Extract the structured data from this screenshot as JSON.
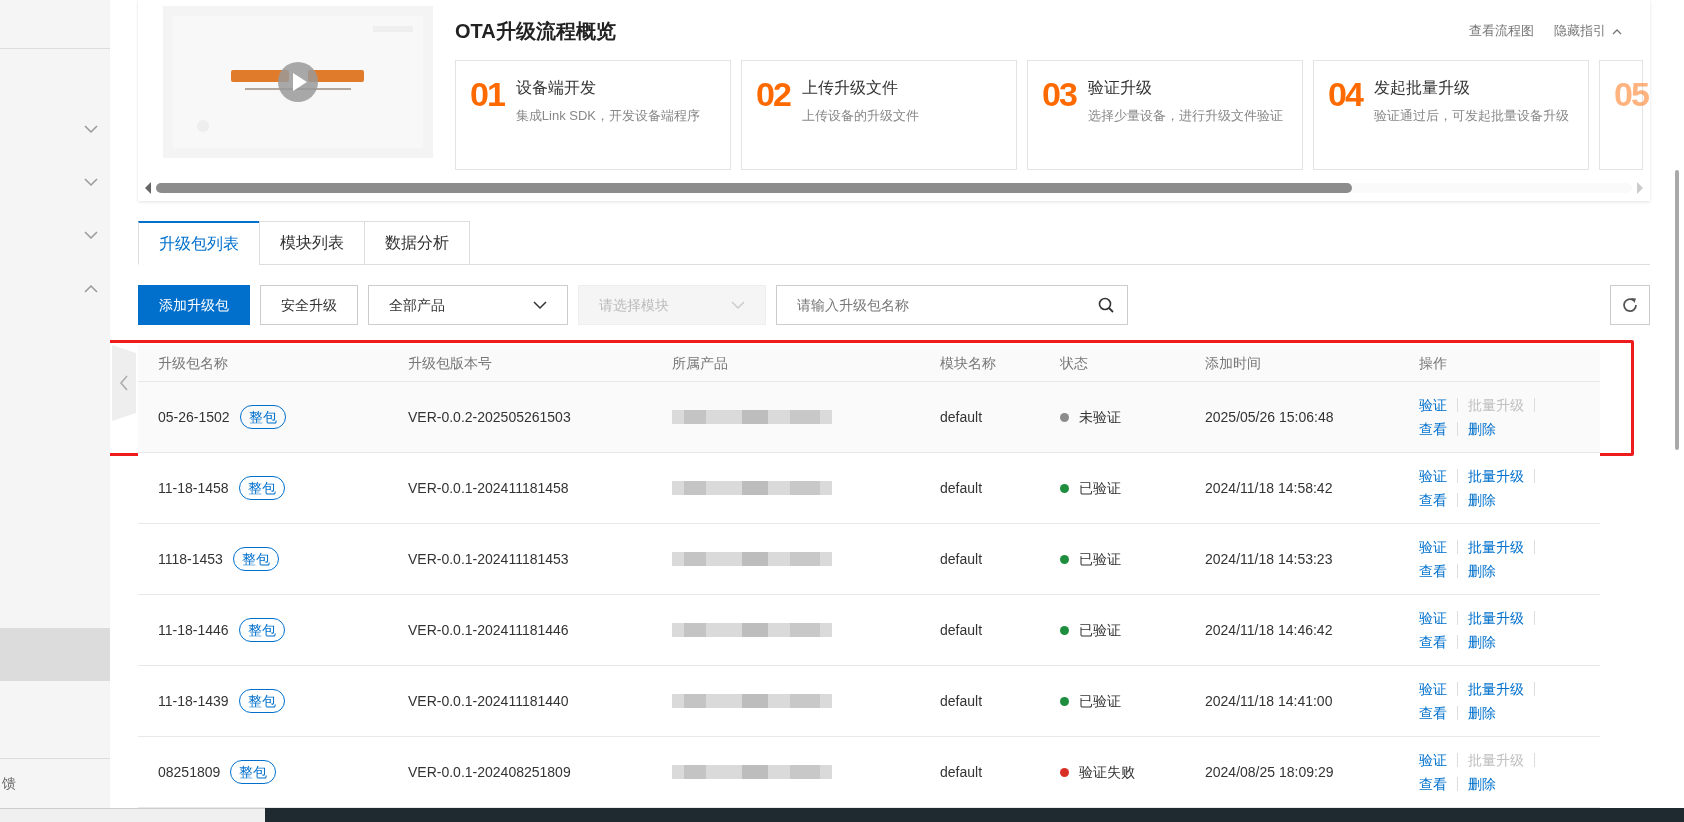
{
  "sidebar": {
    "groups": [
      {
        "expanded": false
      },
      {
        "expanded": false
      },
      {
        "expanded": false
      },
      {
        "expanded": true
      }
    ],
    "items": [
      {
        "selected": true
      }
    ],
    "footer_link": "馈"
  },
  "guide": {
    "title": "OTA升级流程概览",
    "links": [
      "查看流程图",
      "隐藏指引"
    ],
    "expanded": true,
    "steps": [
      {
        "number": "01",
        "title": "设备端开发",
        "desc": "集成Link SDK，开发设备端程序"
      },
      {
        "number": "02",
        "title": "上传升级文件",
        "desc": "上传设备的升级文件"
      },
      {
        "number": "03",
        "title": "验证升级",
        "desc": "选择少量设备，进行升级文件验证"
      },
      {
        "number": "04",
        "title": "发起批量升级",
        "desc": "验证通过后，可发起批量设备升级"
      },
      {
        "number": "05"
      }
    ]
  },
  "tabs": [
    {
      "label": "升级包列表",
      "selected": true
    },
    {
      "label": "模块列表",
      "selected": false
    },
    {
      "label": "数据分析",
      "selected": false
    }
  ],
  "toolbar": {
    "primary_button": "添加升级包",
    "secure_button": "安全升级",
    "product_select": {
      "value": "全部产品",
      "disabled": false
    },
    "module_select": {
      "placeholder": "请选择模块",
      "disabled": true
    },
    "search": {
      "placeholder": "请输入升级包名称"
    }
  },
  "table": {
    "columns": [
      "升级包名称",
      "升级包版本号",
      "所属产品",
      "模块名称",
      "状态",
      "添加时间",
      "操作"
    ],
    "rows": [
      {
        "name": "05-26-1502",
        "tag": "整包",
        "version": "VER-0.0.2-202505261503",
        "module": "default",
        "status": "未验证",
        "color": "#8c8c8c",
        "time": "2025/05/26 15:06:48",
        "highlighted": true,
        "actions": [
          {
            "label": "验证",
            "disabled": false
          },
          {
            "label": "批量升级",
            "disabled": true
          },
          {
            "label": "查看",
            "disabled": false
          },
          {
            "label": "删除",
            "disabled": false
          }
        ]
      },
      {
        "name": "11-18-1458",
        "tag": "整包",
        "version": "VER-0.0.1-202411181458",
        "module": "default",
        "status": "已验证",
        "color": "#1e8e3e",
        "time": "2024/11/18 14:58:42",
        "highlighted": false,
        "actions": [
          {
            "label": "验证",
            "disabled": false
          },
          {
            "label": "批量升级",
            "disabled": false
          },
          {
            "label": "查看",
            "disabled": false
          },
          {
            "label": "删除",
            "disabled": false
          }
        ]
      },
      {
        "name": "1118-1453",
        "tag": "整包",
        "version": "VER-0.0.1-202411181453",
        "module": "default",
        "status": "已验证",
        "color": "#1e8e3e",
        "time": "2024/11/18 14:53:23",
        "highlighted": false,
        "actions": [
          {
            "label": "验证",
            "disabled": false
          },
          {
            "label": "批量升级",
            "disabled": false
          },
          {
            "label": "查看",
            "disabled": false
          },
          {
            "label": "删除",
            "disabled": false
          }
        ]
      },
      {
        "name": "11-18-1446",
        "tag": "整包",
        "version": "VER-0.0.1-202411181446",
        "module": "default",
        "status": "已验证",
        "color": "#1e8e3e",
        "time": "2024/11/18 14:46:42",
        "highlighted": false,
        "actions": [
          {
            "label": "验证",
            "disabled": false
          },
          {
            "label": "批量升级",
            "disabled": false
          },
          {
            "label": "查看",
            "disabled": false
          },
          {
            "label": "删除",
            "disabled": false
          }
        ]
      },
      {
        "name": "11-18-1439",
        "tag": "整包",
        "version": "VER-0.0.1-202411181440",
        "module": "default",
        "status": "已验证",
        "color": "#1e8e3e",
        "time": "2024/11/18 14:41:00",
        "highlighted": false,
        "actions": [
          {
            "label": "验证",
            "disabled": false
          },
          {
            "label": "批量升级",
            "disabled": false
          },
          {
            "label": "查看",
            "disabled": false
          },
          {
            "label": "删除",
            "disabled": false
          }
        ]
      },
      {
        "name": "08251809",
        "tag": "整包",
        "version": "VER-0.0.1-202408251809",
        "module": "default",
        "status": "验证失败",
        "color": "#d93026",
        "time": "2024/08/25 18:09:29",
        "highlighted": false,
        "actions": [
          {
            "label": "验证",
            "disabled": false
          },
          {
            "label": "批量升级",
            "disabled": true
          },
          {
            "label": "查看",
            "disabled": false
          },
          {
            "label": "删除",
            "disabled": false
          }
        ]
      }
    ]
  }
}
